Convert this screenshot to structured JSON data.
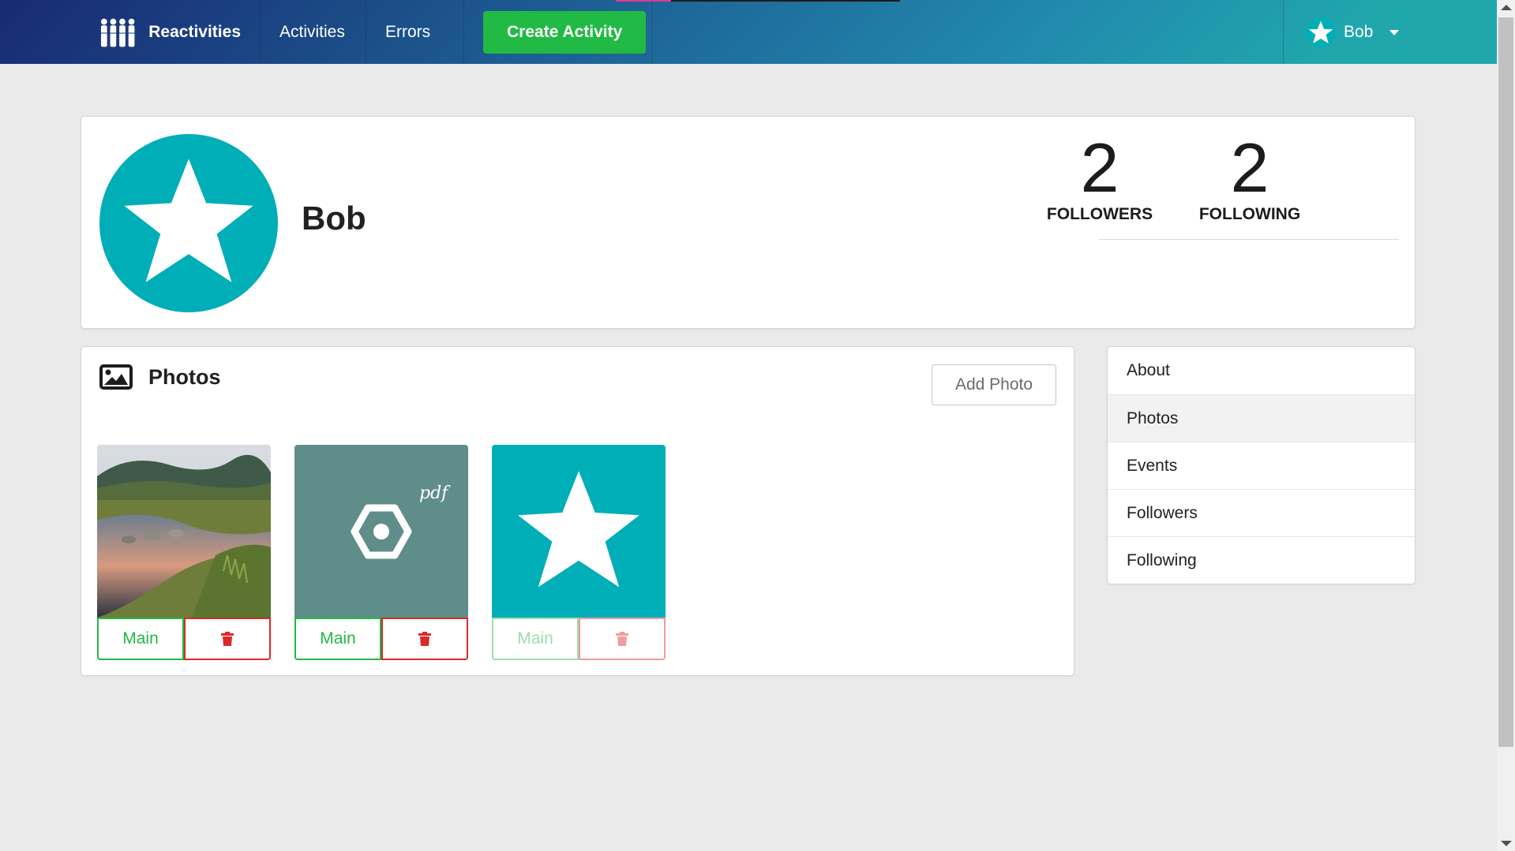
{
  "nav": {
    "brand": "Reactivities",
    "activities": "Activities",
    "errors": "Errors",
    "create": "Create Activity",
    "user": "Bob",
    "brand_icon": "people-icon",
    "user_icon": "star-avatar-icon",
    "dropdown_icon": "caret-down-icon",
    "accent": "#21ba45"
  },
  "profile": {
    "name": "Bob",
    "followers_count": "2",
    "followers_label": "FOLLOWERS",
    "following_count": "2",
    "following_label": "FOLLOWING",
    "avatar_color": "#00aeb8"
  },
  "photos": {
    "title": "Photos",
    "add_label": "Add Photo",
    "items": [
      {
        "type": "landscape-photo",
        "main_label": "Main",
        "delete_icon": "trash-icon",
        "disabled": false
      },
      {
        "type": "pdf-document-photo",
        "main_label": "Main",
        "delete_icon": "trash-icon",
        "disabled": false
      },
      {
        "type": "star-avatar-photo",
        "main_label": "Main",
        "delete_icon": "trash-icon",
        "disabled": true
      }
    ]
  },
  "menu": {
    "items": [
      "About",
      "Photos",
      "Events",
      "Followers",
      "Following"
    ],
    "active": "Photos"
  },
  "pdf_label": "pdf"
}
